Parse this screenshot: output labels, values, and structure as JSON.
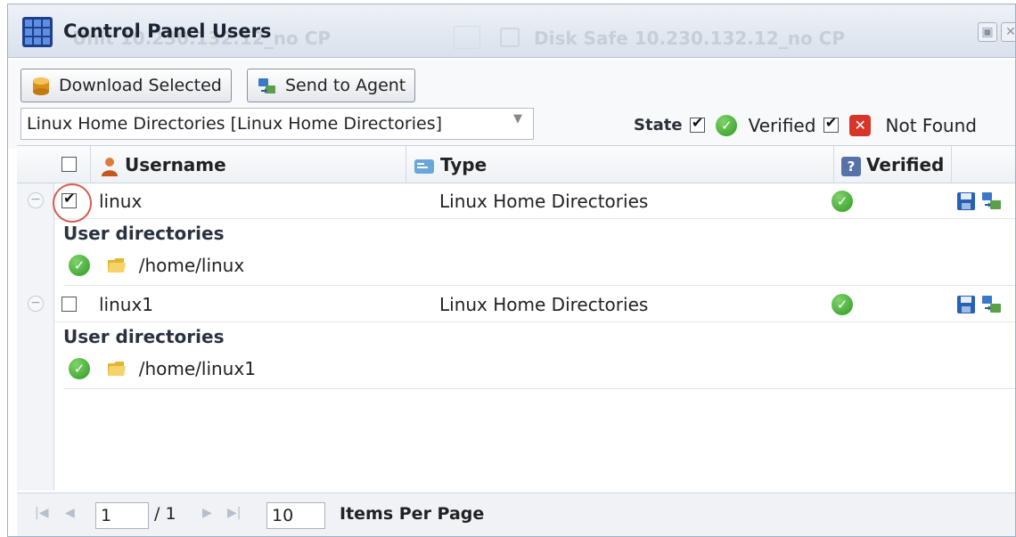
{
  "window": {
    "title": "Control Panel Users",
    "background_text_left": "Unit 10.230.132.12_no CP",
    "background_text_right": "Disk Safe 10.230.132.12_no CP"
  },
  "toolbar": {
    "download_label": "Download Selected",
    "send_label": "Send to Agent",
    "filter_value": "Linux Home Directories [Linux Home Directories]"
  },
  "legend": {
    "state_label": "State",
    "verified_label": "Verified",
    "not_found_label": "Not Found"
  },
  "table": {
    "columns": {
      "username": "Username",
      "type": "Type",
      "verified": "Verified"
    },
    "rows": [
      {
        "username": "linux",
        "type": "Linux Home Directories",
        "checked": true,
        "detail_title": "User directories",
        "path": "/home/linux"
      },
      {
        "username": "linux1",
        "type": "Linux Home Directories",
        "checked": false,
        "detail_title": "User directories",
        "path": "/home/linux1"
      }
    ]
  },
  "pager": {
    "page": "1",
    "page_total": "/ 1",
    "per_page": "10",
    "per_page_label": "Items Per Page"
  },
  "colors": {
    "accent": "#2f9a23",
    "not_found": "#d8342a",
    "highlight_circle": "#d9584c"
  },
  "icons": [
    "grid-app-icon",
    "database-icon",
    "agent-icon",
    "user-icon",
    "type-icon",
    "question-icon",
    "check-icon",
    "error-icon",
    "folder-icon",
    "save-icon",
    "send-icon"
  ]
}
